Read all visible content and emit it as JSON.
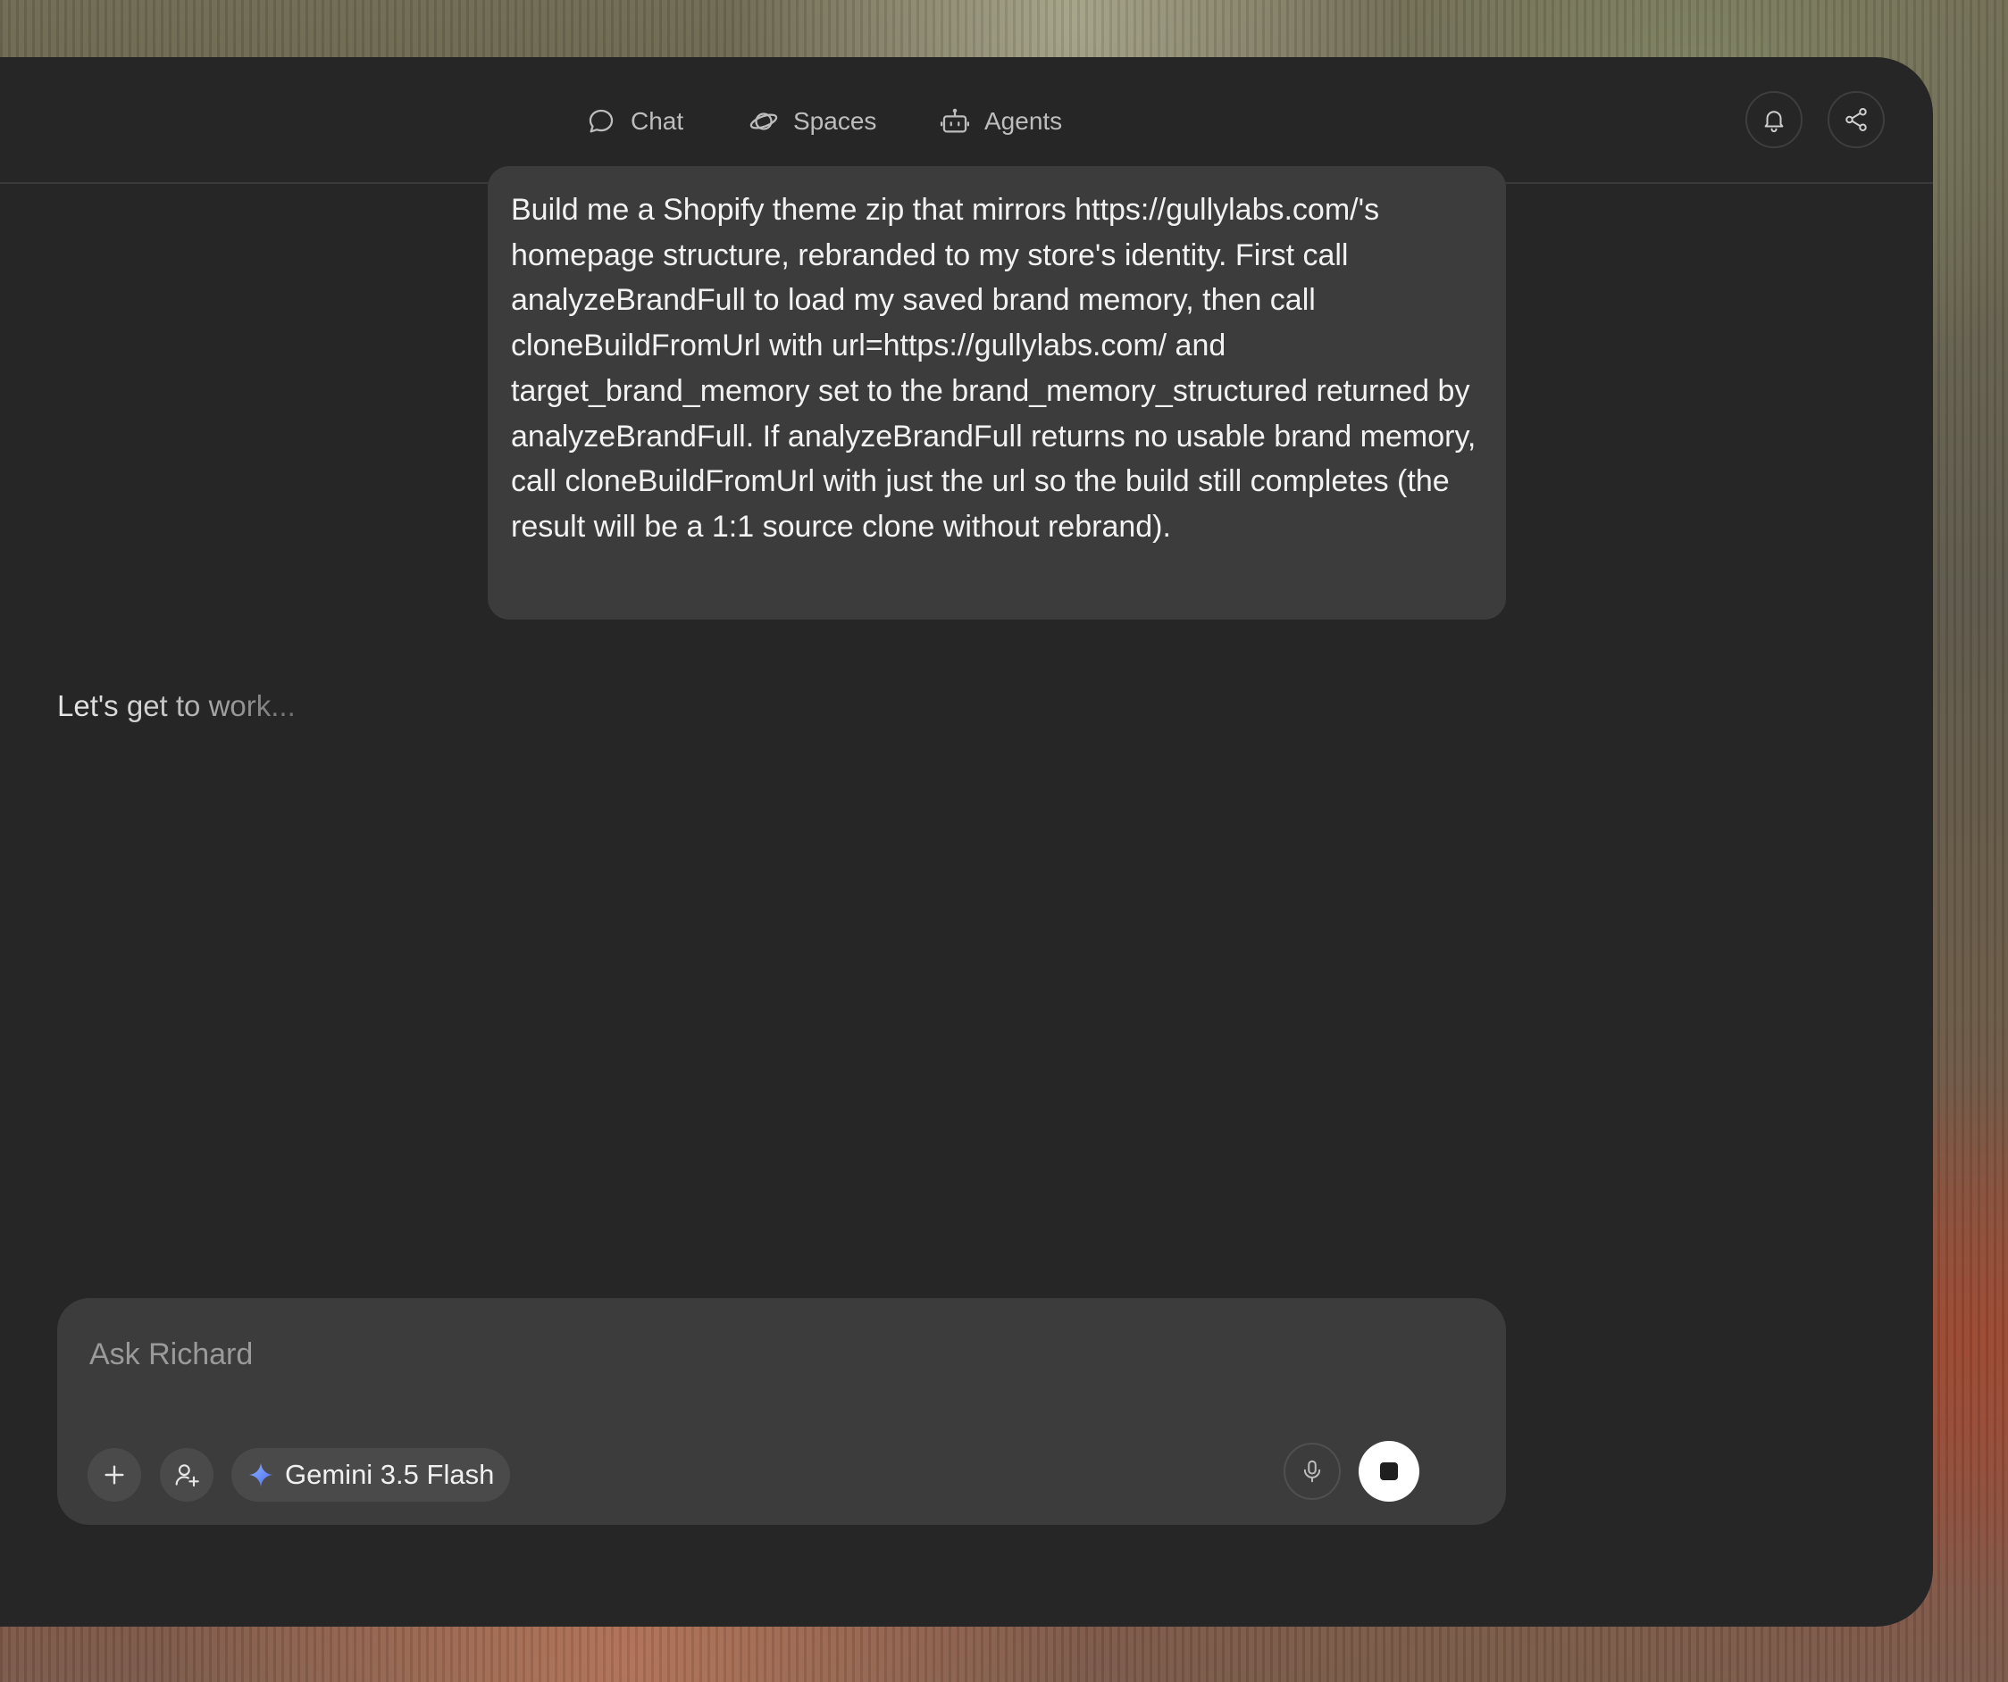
{
  "nav": {
    "chat": "Chat",
    "spaces": "Spaces",
    "agents": "Agents"
  },
  "message": {
    "text": "Build me a Shopify theme zip that mirrors https://gullylabs.com/'s homepage structure, rebranded to my store's identity. First call analyzeBrandFull to load my saved brand memory, then call cloneBuildFromUrl with url=https://gullylabs.com/ and target_brand_memory set to the brand_memory_structured returned by analyzeBrandFull. If analyzeBrandFull returns no usable brand memory, call cloneBuildFromUrl with just the url so the build still completes (the result will be a 1:1 source clone without rebrand)."
  },
  "status": {
    "text": "Let's get to work..."
  },
  "composer": {
    "placeholder": "Ask Richard",
    "model": "Gemini 3.5 Flash"
  },
  "icons": {
    "chat": "chat-bubble-icon",
    "spaces": "planet-icon",
    "agents": "robot-icon",
    "bell": "bell-icon",
    "share": "share-icon",
    "plus": "plus-icon",
    "persona": "user-plus-icon",
    "model": "sparkle-icon",
    "mic": "microphone-icon",
    "stop": "stop-icon"
  },
  "colors": {
    "window_bg": "#262626",
    "bubble_bg": "#3c3c3c",
    "composer_bg": "#3c3c3c",
    "sparkle_blue": "#5b8cff"
  }
}
